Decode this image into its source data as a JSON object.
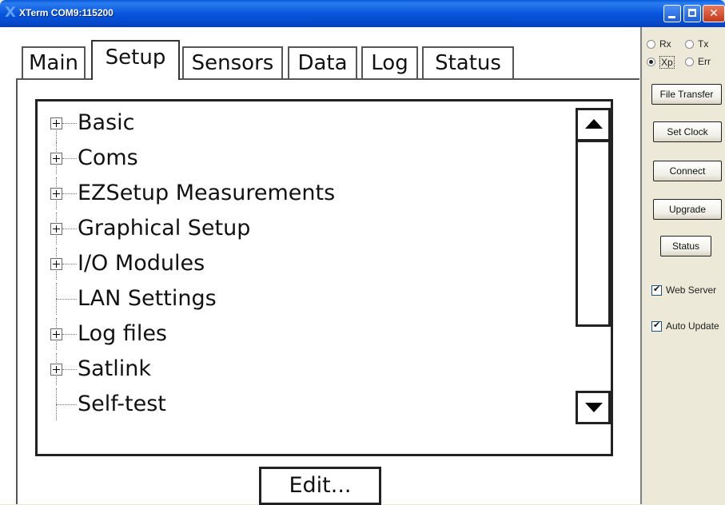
{
  "window": {
    "title": "XTerm COM9:115200",
    "app_glyph": "X"
  },
  "tabs": [
    {
      "label": "Main",
      "active": false
    },
    {
      "label": "Setup",
      "active": true
    },
    {
      "label": "Sensors",
      "active": false
    },
    {
      "label": "Data",
      "active": false
    },
    {
      "label": "Log",
      "active": false
    },
    {
      "label": "Status",
      "active": false
    }
  ],
  "tree": {
    "items": [
      {
        "label": "Basic",
        "expandable": true
      },
      {
        "label": "Coms",
        "expandable": true
      },
      {
        "label": "EZSetup Measurements",
        "expandable": true
      },
      {
        "label": "Graphical Setup",
        "expandable": true
      },
      {
        "label": "I/O Modules",
        "expandable": true
      },
      {
        "label": "LAN Settings",
        "expandable": false
      },
      {
        "label": "Log files",
        "expandable": true
      },
      {
        "label": "Satlink",
        "expandable": true
      },
      {
        "label": "Self-test",
        "expandable": false
      }
    ]
  },
  "edit_button": {
    "label": "Edit..."
  },
  "side_panel": {
    "radios": [
      {
        "label": "Rx",
        "checked": false
      },
      {
        "label": "Tx",
        "checked": false
      },
      {
        "label": "Xp",
        "checked": true
      },
      {
        "label": "Err",
        "checked": false
      }
    ],
    "buttons": {
      "file_transfer": "File Transfer",
      "set_clock": "Set Clock",
      "connect": "Connect",
      "upgrade": "Upgrade",
      "status": "Status"
    },
    "checkboxes": [
      {
        "label": "Web Server",
        "checked": true
      },
      {
        "label": "Auto Update",
        "checked": true
      }
    ]
  },
  "colors": {
    "titlebar": "#0a5bd8",
    "close_button": "#c3381a",
    "panel_bg": "#ece9d8"
  }
}
